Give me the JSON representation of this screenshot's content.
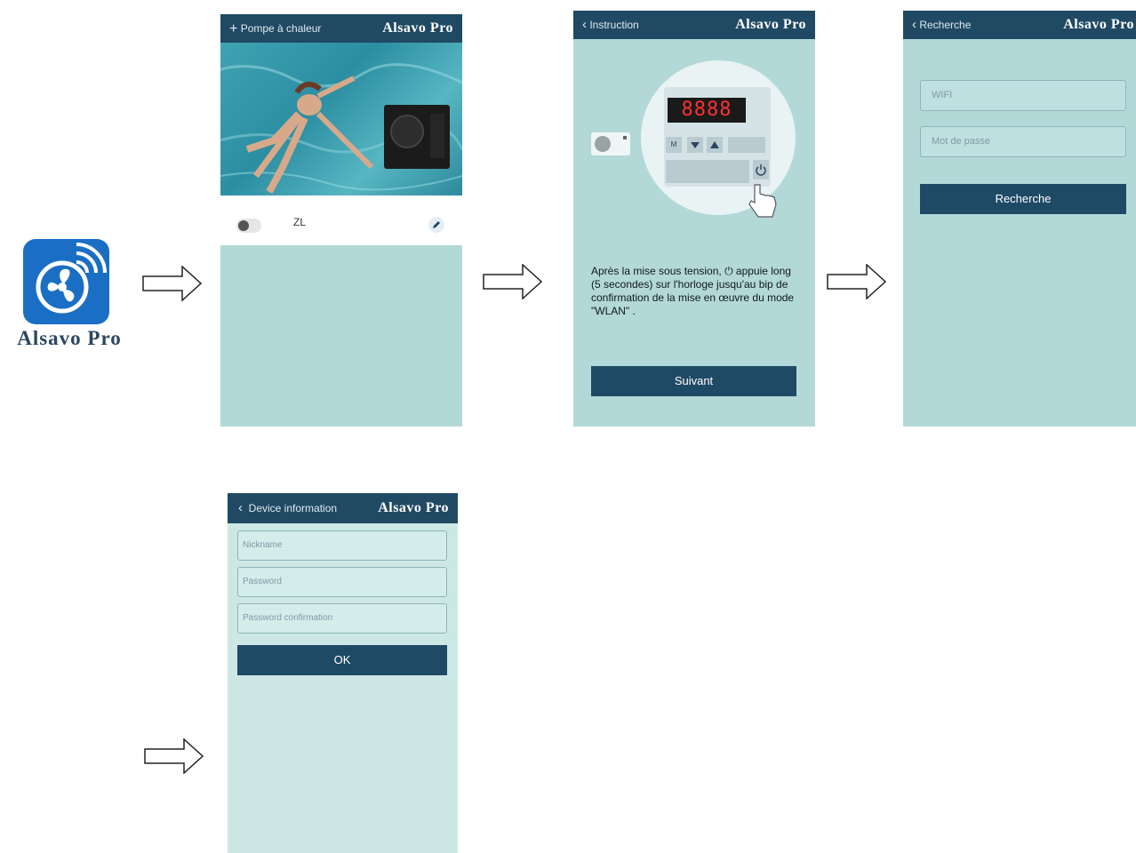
{
  "app_icon": {
    "name": "Alsavo Pro",
    "color": "#1a6fc4"
  },
  "brand": "Alsavo Pro",
  "screen1": {
    "header_left": "Pompe à chaleur",
    "device_name": "ZL"
  },
  "screen2": {
    "header_left": "Instruction",
    "display": "8888",
    "m_key": "M",
    "instruction_text": "Après la mise sous tension, ⏻ appuie long (5 secondes)  sur l'horloge jusqu'au bip de confirmation de la mise en œuvre du mode \"WLAN\" .",
    "next_button": "Suivant"
  },
  "screen3": {
    "header_left": "Recherche",
    "wifi_placeholder": "WIFI",
    "password_placeholder": "Mot de passe",
    "search_button": "Recherche"
  },
  "screen4": {
    "header_left": "Device information",
    "nickname_placeholder": "Nickname",
    "password_placeholder": "Password",
    "password_confirm_placeholder": "Password confirmation",
    "ok_button": "OK"
  },
  "colors": {
    "header": "#204a64",
    "background": "#b3d8d8",
    "button": "#1f4a66"
  }
}
